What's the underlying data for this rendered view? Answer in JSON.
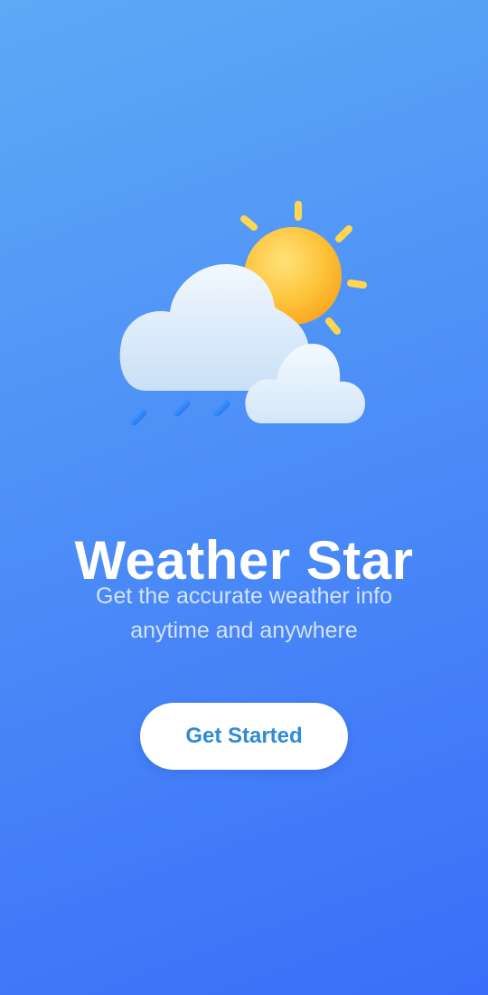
{
  "illustration": {
    "icon": "weather-partly-cloudy-rain-icon"
  },
  "app": {
    "title": "Weather Star"
  },
  "tagline": {
    "line1": "Get the accurate weather info",
    "line2": "anytime and anywhere"
  },
  "cta": {
    "label": "Get Started"
  },
  "colors": {
    "background_top": "#5ea9f6",
    "background_bottom": "#3a6ef9",
    "button_text": "#2f8ad8",
    "button_bg": "#ffffff",
    "sun": "#fbc02d",
    "rain": "#2f7ef5"
  }
}
